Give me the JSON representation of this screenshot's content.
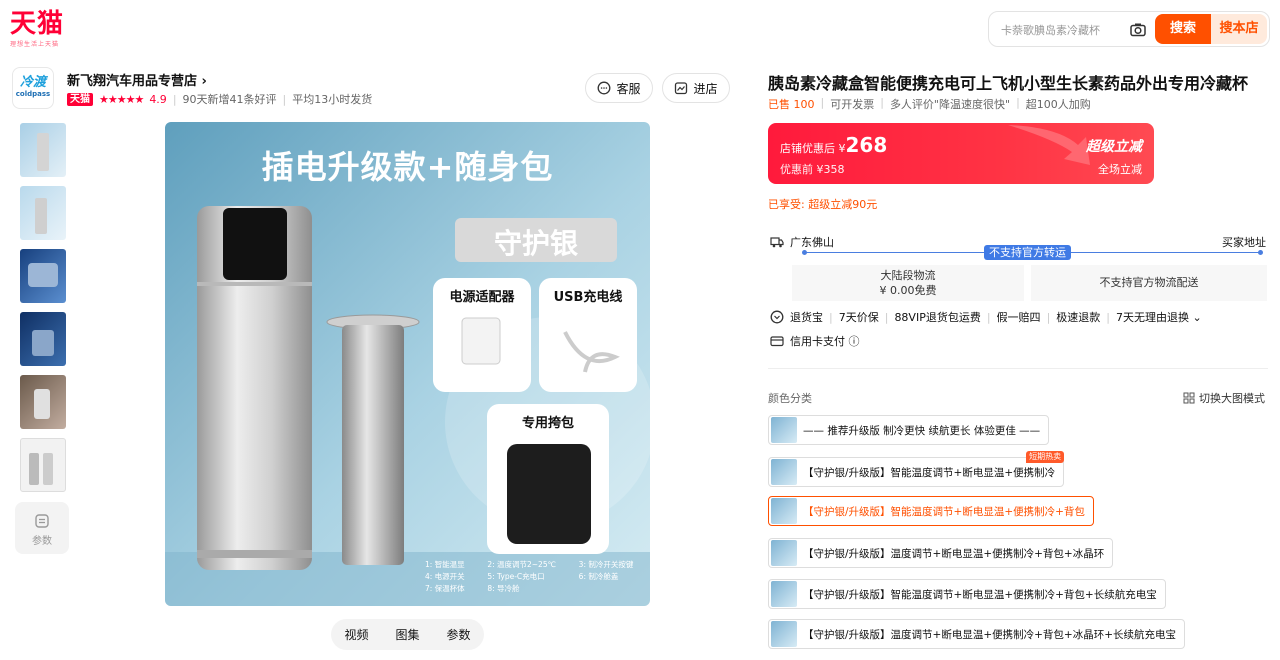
{
  "header": {
    "logo_text": "天猫",
    "logo_slogan": "理想生活上天猫",
    "search_placeholder": "卡萘歌腆岛素冷藏杯",
    "search_button": "搜索",
    "store_search_button": "搜本店"
  },
  "store": {
    "logo_line1": "冷渡",
    "logo_line2": "coldpass",
    "name": "新飞翔汽车用品专营店 ›",
    "tmall_badge": "天猫",
    "stars": "★★★★★",
    "rating": "4.9",
    "good_reviews": "90天新增41条好评",
    "ship_time": "平均13小时发货",
    "service_button": "客服",
    "enter_button": "进店"
  },
  "gallery": {
    "params_label": "参数",
    "media_tabs": [
      "视频",
      "图集",
      "参数"
    ]
  },
  "main_image": {
    "headline": "插电升级款+随身包",
    "edition": "守护银",
    "adapter_label": "电源适配器",
    "usb_label": "USB充电线",
    "bag_label": "专用挎包",
    "legend": [
      "1: 智能温显",
      "2: 温度调节2~25℃",
      "3: 制冷开关按键",
      "4: 电源开关",
      "5: Type-C充电口",
      "6: 制冷舱盖",
      "7: 保温杯体",
      "8: 导冷舱"
    ]
  },
  "product": {
    "title": "胰岛素冷藏盒智能便携充电可上飞机小型生长素药品外出专用冷藏杯",
    "sold": "已售 100",
    "invoice": "可开发票",
    "reviews": "多人评价\"降温速度很快\"",
    "cart": "超100人加购",
    "price_label": "店铺优惠后 ¥",
    "price": "268",
    "original_price": "优惠前 ¥358",
    "promo_title": "超级立减",
    "promo_sub": "全场立减",
    "discount_note": "已享受: 超级立减90元"
  },
  "shipping": {
    "origin": "广东佛山",
    "destination": "买家地址",
    "flag": "不支持官方转运",
    "mainland_label": "大陆段物流",
    "mainland_fee": "¥ 0.00免费",
    "official": "不支持官方物流配送"
  },
  "services": {
    "items": [
      "退货宝",
      "7天价保",
      "88VIP退货包运费",
      "假一赔四",
      "极速退款",
      "7天无理由退换 ⌄"
    ],
    "credit": "信用卡支付 ⓘ"
  },
  "sku": {
    "label": "颜色分类",
    "toggle": "切换大图模式",
    "options": [
      "—— 推荐升级版 制冷更快 续航更长 体验更佳 ——",
      "【守护银/升级版】智能温度调节+断电显温+便携制冷",
      "【守护银/升级版】智能温度调节+断电显温+便携制冷+背包",
      "【守护银/升级版】温度调节+断电显温+便携制冷+背包+冰晶环",
      "【守护银/升级版】智能温度调节+断电显温+便携制冷+背包+长续航充电宝",
      "【守护银/升级版】温度调节+断电显温+便携制冷+背包+冰晶环+长续航充电宝"
    ],
    "badge": "短期热卖"
  },
  "colors": {
    "tmall_red": "#ff0036",
    "orange": "#ff5000",
    "ship_blue": "#3f7ae5"
  }
}
